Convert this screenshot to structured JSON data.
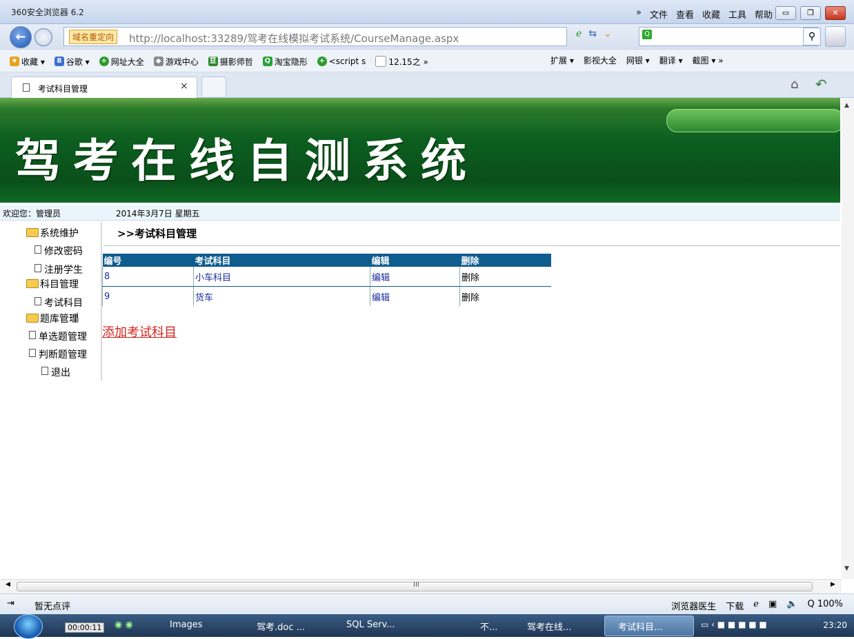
{
  "window": {
    "title": "360安全浏览器 6.2",
    "menu": [
      "»",
      "文件",
      "查看",
      "收藏",
      "工具",
      "帮助"
    ],
    "controls": {
      "minimize": "▭",
      "restore": "❐",
      "close": "✕"
    }
  },
  "address_bar": {
    "redirect_tag": "域名重定向",
    "url": "http://localhost:33289/驾考在线模拟考试系统/CourseManage.aspx",
    "search_value": ""
  },
  "favorites": {
    "items": [
      {
        "label": "收藏 ▾",
        "icon": "star-icon",
        "color": "#e8a21a"
      },
      {
        "label": "谷歌 ▾",
        "icon": "google-icon",
        "color": "#3b6fd6"
      },
      {
        "label": "网址大全",
        "icon": "nav-icon",
        "color": "#2c9a2c"
      },
      {
        "label": "游戏中心",
        "icon": "game-icon",
        "color": "#888888"
      },
      {
        "label": "摄影师哲",
        "icon": "douban-icon",
        "color": "#2d8a2d"
      },
      {
        "label": "淘宝隐形",
        "icon": "taobao-icon",
        "color": "#27a035"
      },
      {
        "label": "<script s",
        "icon": "nav-icon",
        "color": "#2c9a2c"
      },
      {
        "label": "12.15之 »",
        "icon": "page-icon",
        "color": "#cccccc"
      }
    ],
    "right": [
      "扩展 ▾",
      "影视大全",
      "网银 ▾",
      "翻译 ▾",
      "截图 ▾ »"
    ]
  },
  "tabs": {
    "active_label": "考试科目管理",
    "close": "×"
  },
  "page": {
    "banner_title": "驾考在线自测系统",
    "welcome": "欢迎您：管理员",
    "date": "2014年3月7日 星期五",
    "sidebar": [
      {
        "label": "系统维护",
        "type": "folder"
      },
      {
        "label": "修改密码",
        "type": "doc"
      },
      {
        "label": "注册学生",
        "type": "doc"
      },
      {
        "label": "科目管理",
        "type": "folder"
      },
      {
        "label": "考试科目",
        "type": "doc"
      },
      {
        "label": "题库管理",
        "type": "folder"
      },
      {
        "label": "单选题管理",
        "type": "doc"
      },
      {
        "label": "判断题管理",
        "type": "doc"
      },
      {
        "label": "退出",
        "type": "doc"
      }
    ],
    "content_title": ">>考试科目管理",
    "table": {
      "headers": [
        "编号",
        "考试科目",
        "编辑",
        "删除"
      ],
      "rows": [
        {
          "id": "8",
          "name": "小车科目",
          "edit": "编辑",
          "delete": "删除"
        },
        {
          "id": "9",
          "name": "货车",
          "edit": "编辑",
          "delete": "删除"
        }
      ]
    },
    "add_link": "添加考试科目"
  },
  "scrollbars": {
    "grip": "III"
  },
  "status_bar": {
    "left": "暂无点评",
    "right": [
      "浏览器医生",
      "下载",
      "ℯ",
      "▣",
      "🔈",
      "Q 100%"
    ]
  },
  "taskbar": {
    "timer": "00:00:11",
    "tasks": [
      "Images",
      "驾考.doc ...",
      "SQL Serv...",
      "不...",
      "驾考在线...",
      "考试科目..."
    ],
    "clock": "23:20"
  },
  "colors": {
    "banner_green": "#0a4f1a",
    "table_header": "#0f5c8e",
    "add_link": "#d8231d"
  }
}
